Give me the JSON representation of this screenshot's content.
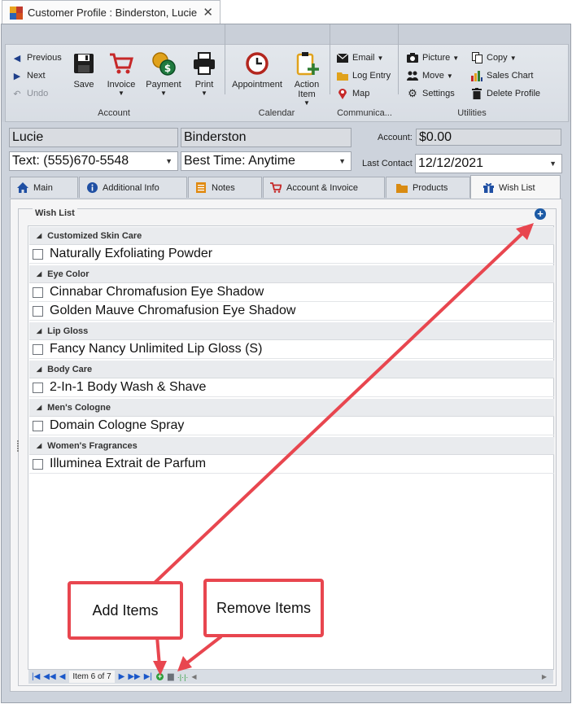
{
  "window": {
    "title": "Customer Profile : Binderston, Lucie",
    "close_glyph": "✕"
  },
  "ribbon": {
    "nav": {
      "previous": "Previous",
      "next": "Next",
      "undo": "Undo"
    },
    "account": {
      "save": "Save",
      "invoice": "Invoice",
      "payment": "Payment",
      "print": "Print",
      "group_label": "Account"
    },
    "calendar": {
      "appointment": "Appointment",
      "action_item": "Action Item",
      "group_label": "Calendar"
    },
    "communication": {
      "email": "Email",
      "log_entry": "Log Entry",
      "map": "Map",
      "group_label": "Communica..."
    },
    "utilities": {
      "picture": "Picture",
      "move": "Move",
      "settings": "Settings",
      "copy": "Copy",
      "sales_chart": "Sales Chart",
      "delete_profile": "Delete Profile",
      "group_label": "Utilities"
    }
  },
  "profile": {
    "first_name": "Lucie",
    "last_name": "Binderston",
    "contact": "Text: (555)670-5548",
    "best_time": "Best Time: Anytime",
    "account_label": "Account:",
    "account_value": "$0.00",
    "last_contact_label": "Last Contact",
    "last_contact_value": "12/12/2021"
  },
  "tabs": [
    {
      "label": "Main",
      "icon": "home-icon"
    },
    {
      "label": "Additional Info",
      "icon": "info-icon"
    },
    {
      "label": "Notes",
      "icon": "notes-icon"
    },
    {
      "label": "Account & Invoice",
      "icon": "cart-icon"
    },
    {
      "label": "Products",
      "icon": "folder-icon"
    },
    {
      "label": "Wish List",
      "icon": "gift-icon"
    }
  ],
  "wish_list": {
    "title": "Wish List",
    "groups": [
      {
        "name": "Customized Skin Care",
        "items": [
          "Naturally Exfoliating Powder"
        ]
      },
      {
        "name": "Eye Color",
        "items": [
          "Cinnabar Chromafusion Eye Shadow",
          "Golden Mauve Chromafusion Eye Shadow"
        ]
      },
      {
        "name": "Lip Gloss",
        "items": [
          "Fancy Nancy Unlimited Lip Gloss (S)"
        ]
      },
      {
        "name": "Body Care",
        "items": [
          "2-In-1 Body Wash & Shave"
        ]
      },
      {
        "name": "Men's Cologne",
        "items": [
          "Domain Cologne Spray"
        ]
      },
      {
        "name": "Women's Fragrances",
        "items": [
          "Illuminea Extrait de Parfum"
        ]
      }
    ],
    "navigator_text": "Item 6 of 7"
  },
  "annotations": {
    "add_items": "Add Items",
    "remove_items": "Remove Items",
    "color": "#e8464f"
  }
}
